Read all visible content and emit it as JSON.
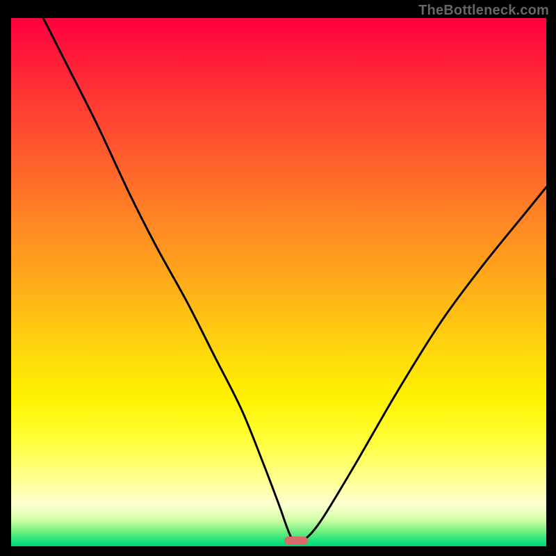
{
  "watermark": "TheBottleneck.com",
  "marker": {
    "x_pct": 53.2,
    "y_pct": 99.0,
    "color": "#d96b6b"
  },
  "chart_data": {
    "type": "line",
    "title": "",
    "xlabel": "",
    "ylabel": "",
    "xlim": [
      0,
      100
    ],
    "ylim": [
      0,
      100
    ],
    "grid": false,
    "legend": false,
    "background": "vertical-gradient red→orange→yellow→green",
    "series": [
      {
        "name": "bottleneck-curve",
        "x": [
          6,
          10,
          16,
          22,
          27,
          33,
          38,
          43,
          47,
          50,
          52,
          53.2,
          55,
          58,
          64,
          72,
          80,
          88,
          96,
          100
        ],
        "values": [
          100,
          92,
          80,
          67,
          57,
          46,
          36,
          26,
          16,
          8,
          2.4,
          0.6,
          1.4,
          5,
          15,
          29,
          42,
          53,
          63,
          68
        ]
      }
    ],
    "annotations": [
      {
        "type": "marker",
        "x": 53.2,
        "y": 0.6,
        "label": "optimal-point",
        "shape": "rounded-rect",
        "color": "#d96b6b"
      }
    ]
  }
}
